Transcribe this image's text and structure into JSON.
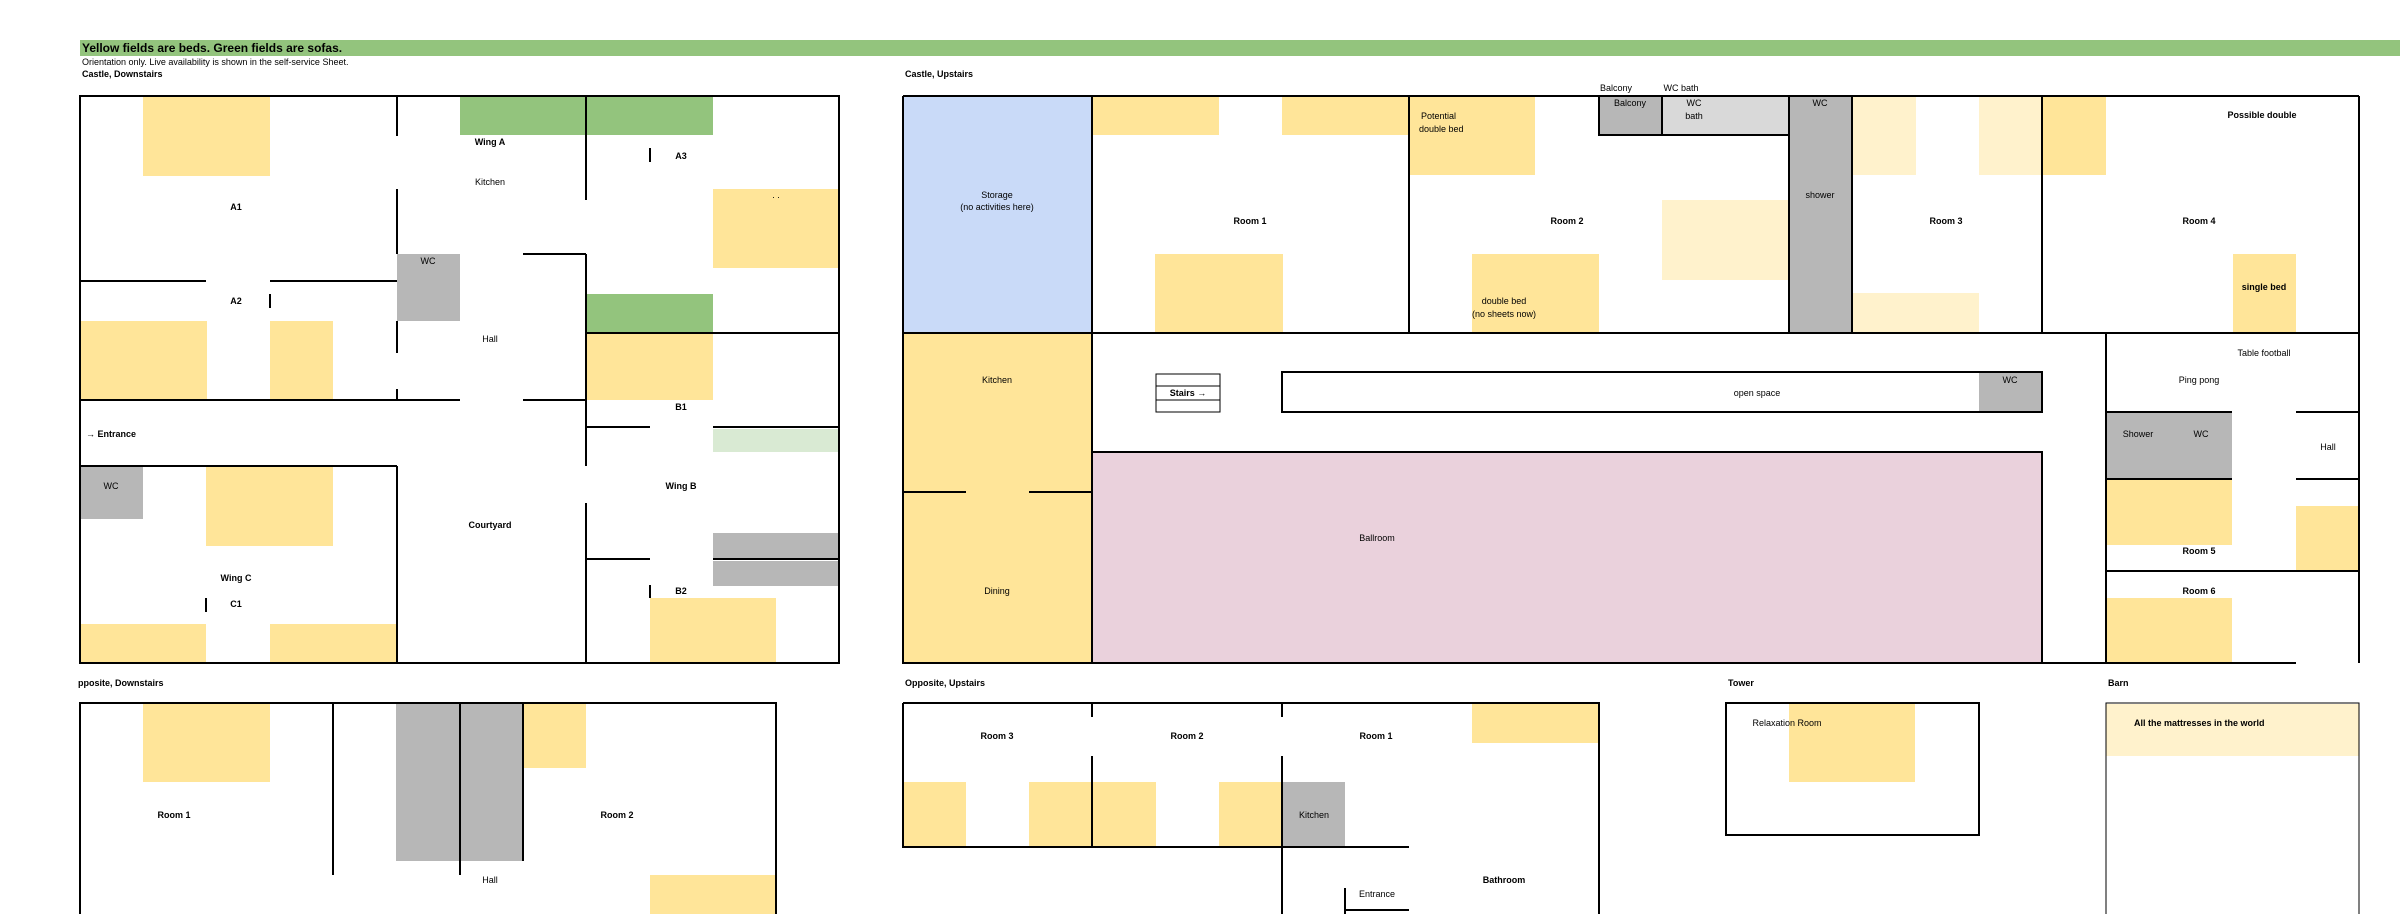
{
  "banner": "Yellow fields are beds. Green fields are sofas.",
  "note": "Orientation only. Live availability is shown in the self-service Sheet.",
  "colors": {
    "bed": "#ffe599",
    "bed_light": "#fff2cc",
    "sofa": "#93c47d",
    "sofa_light": "#d9ead3",
    "wc": "#b7b7b7",
    "wc_light": "#d9d9d9",
    "storage": "#c9daf8",
    "ballroom": "#ead1dc",
    "banner": "#93c47d"
  },
  "sections": {
    "castle_down": "Castle, Downstairs",
    "castle_up": "Castle, Upstairs",
    "opp_down": "pposite, Downstairs",
    "opp_up": "Opposite, Upstairs",
    "tower": "Tower",
    "barn": "Barn"
  },
  "castle_down": {
    "a1": "A1",
    "a2": "A2",
    "wing_a": "Wing A",
    "kitchen": "Kitchen",
    "a3": "A3",
    "dots": ".             .",
    "wc": "WC",
    "hall": "Hall",
    "b1": "B1",
    "entrance": "→ Entrance",
    "wc2": "WC",
    "wing_b": "Wing B",
    "courtyard": "Courtyard",
    "wing_c": "Wing C",
    "c1": "C1",
    "b2": "B2"
  },
  "castle_up": {
    "storage_1": "Storage",
    "storage_2": "(no activities here)",
    "room1": "Room 1",
    "potential_1": "Potential",
    "potential_2": "double bed",
    "room2": "Room 2",
    "double_1": "double bed",
    "double_2": "(no sheets now)",
    "balcony_top": "Balcony",
    "wcbath_top": "WC bath",
    "balcony": "Balcony",
    "wc_bath_1": "WC",
    "wc_bath_2": "bath",
    "wc": "WC",
    "shower": "shower",
    "room3": "Room 3",
    "possible_double": "Possible double",
    "room4": "Room 4",
    "single_bed": "single bed",
    "kitchen": "Kitchen",
    "stairs": "Stairs →",
    "open_space": "open space",
    "wc2": "WC",
    "table_football": "Table football",
    "ping_pong": "Ping pong",
    "shower2": "Shower",
    "wc3": "WC",
    "hall": "Hall",
    "ballroom": "Ballroom",
    "dining": "Dining",
    "room5": "Room 5",
    "room6": "Room 6"
  },
  "opp_down": {
    "room1": "Room 1",
    "room2": "Room 2",
    "hall": "Hall"
  },
  "opp_up": {
    "room3": "Room 3",
    "room2": "Room 2",
    "room1": "Room 1",
    "kitchen": "Kitchen",
    "bathroom": "Bathroom",
    "entrance": "Entrance"
  },
  "tower": {
    "relax": "Relaxation Room"
  },
  "barn": {
    "mattresses": "All the mattresses in the world"
  }
}
